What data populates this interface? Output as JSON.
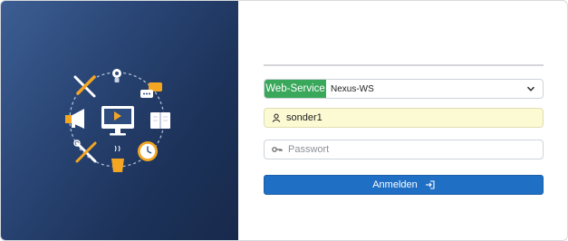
{
  "login": {
    "service_label": "Web-Service",
    "service_value": "Nexus-WS",
    "username_value": "sonder1",
    "password_placeholder": "Passwort",
    "submit_label": "Anmelden"
  },
  "icons": {
    "service_dropdown": "chevron-down-icon",
    "username": "user-icon",
    "password": "key-icon",
    "submit": "sign-in-icon"
  },
  "colors": {
    "hero_gradient_start": "#3d5e93",
    "hero_gradient_end": "#182a4c",
    "service_label_bg": "#3aa85b",
    "autofill_bg": "#fcfad2",
    "primary_button": "#1f6fc5",
    "illustration_accent": "#f4a623"
  }
}
